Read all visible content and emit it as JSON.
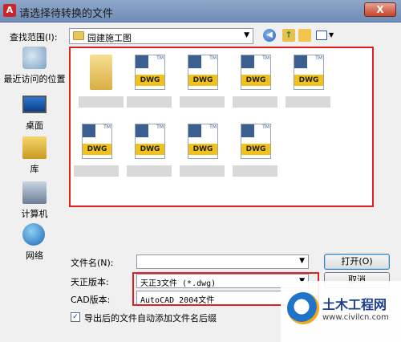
{
  "window": {
    "title": "请选择待转换的文件",
    "close_label": "X"
  },
  "lookin": {
    "label": "查找范围(I):",
    "value": "园建施工图"
  },
  "places": [
    {
      "label": "最近访问的位置"
    },
    {
      "label": "桌面"
    },
    {
      "label": "库"
    },
    {
      "label": "计算机"
    },
    {
      "label": "网络"
    }
  ],
  "files": {
    "icon_label": "DWG",
    "tm": "TM"
  },
  "form": {
    "filename_label": "文件名(N):",
    "filename_value": "",
    "tianzheng_label": "天正版本:",
    "tianzheng_value": "天正3文件 (*.dwg)",
    "cad_label": "CAD版本:",
    "cad_value": "AutoCAD 2004文件",
    "open_button": "打开(O)",
    "cancel_button": "取消",
    "checkbox_label": "导出后的文件自动添加文件名后缀",
    "checkbox_checked": "✓"
  },
  "watermark": {
    "title": "土木工程网",
    "url": "www.civilcn.com"
  },
  "colors": {
    "highlight": "#e02020",
    "dwg_band": "#f2c21b",
    "titlebar": "#7f99c0"
  }
}
